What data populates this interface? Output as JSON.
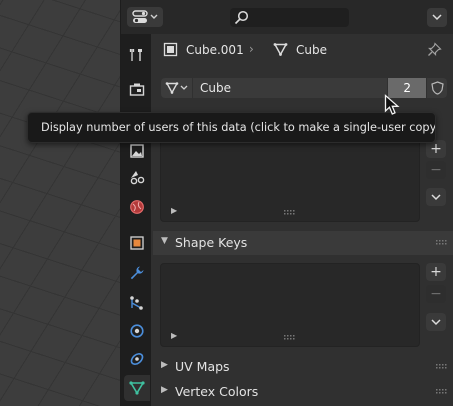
{
  "header": {
    "editor_type_icon": "properties-editor-icon",
    "search_icon": "search-icon",
    "search_placeholder": "",
    "menu_icon": "chevron-down-icon"
  },
  "tabs": [
    {
      "name": "tool",
      "icon": "tool-icon",
      "active": false
    },
    {
      "name": "render",
      "icon": "render-icon",
      "active": false
    },
    {
      "name": "output",
      "icon": "output-icon",
      "active": false
    },
    {
      "name": "view-layer",
      "icon": "view-layer-icon",
      "active": false
    },
    {
      "name": "scene",
      "icon": "scene-icon",
      "active": false
    },
    {
      "name": "world",
      "icon": "world-icon",
      "active": false
    },
    {
      "name": "object",
      "icon": "object-icon",
      "active": false
    },
    {
      "name": "modifiers",
      "icon": "wrench-icon",
      "active": false
    },
    {
      "name": "particles",
      "icon": "particles-icon",
      "active": false
    },
    {
      "name": "physics",
      "icon": "physics-icon",
      "active": false
    },
    {
      "name": "constraints",
      "icon": "constraints-icon",
      "active": false
    },
    {
      "name": "data",
      "icon": "mesh-data-icon",
      "active": true
    }
  ],
  "breadcrumb": {
    "object": "Cube.001",
    "mesh": "Cube",
    "separator": "›"
  },
  "datablock": {
    "name": "Cube",
    "users": "2"
  },
  "tooltip": "Display number of users of this data (click to make a single-user copy).",
  "panels": {
    "shape_keys": {
      "title": "Shape Keys",
      "expanded": true
    },
    "uv_maps": {
      "title": "UV Maps",
      "expanded": false
    },
    "vertex_colors": {
      "title": "Vertex Colors",
      "expanded": false
    }
  },
  "buttons": {
    "add": "+",
    "remove": "−"
  },
  "colors": {
    "accent": "#e6883d",
    "active_tab": "#303030",
    "data_icon": "#3fc1a0"
  }
}
